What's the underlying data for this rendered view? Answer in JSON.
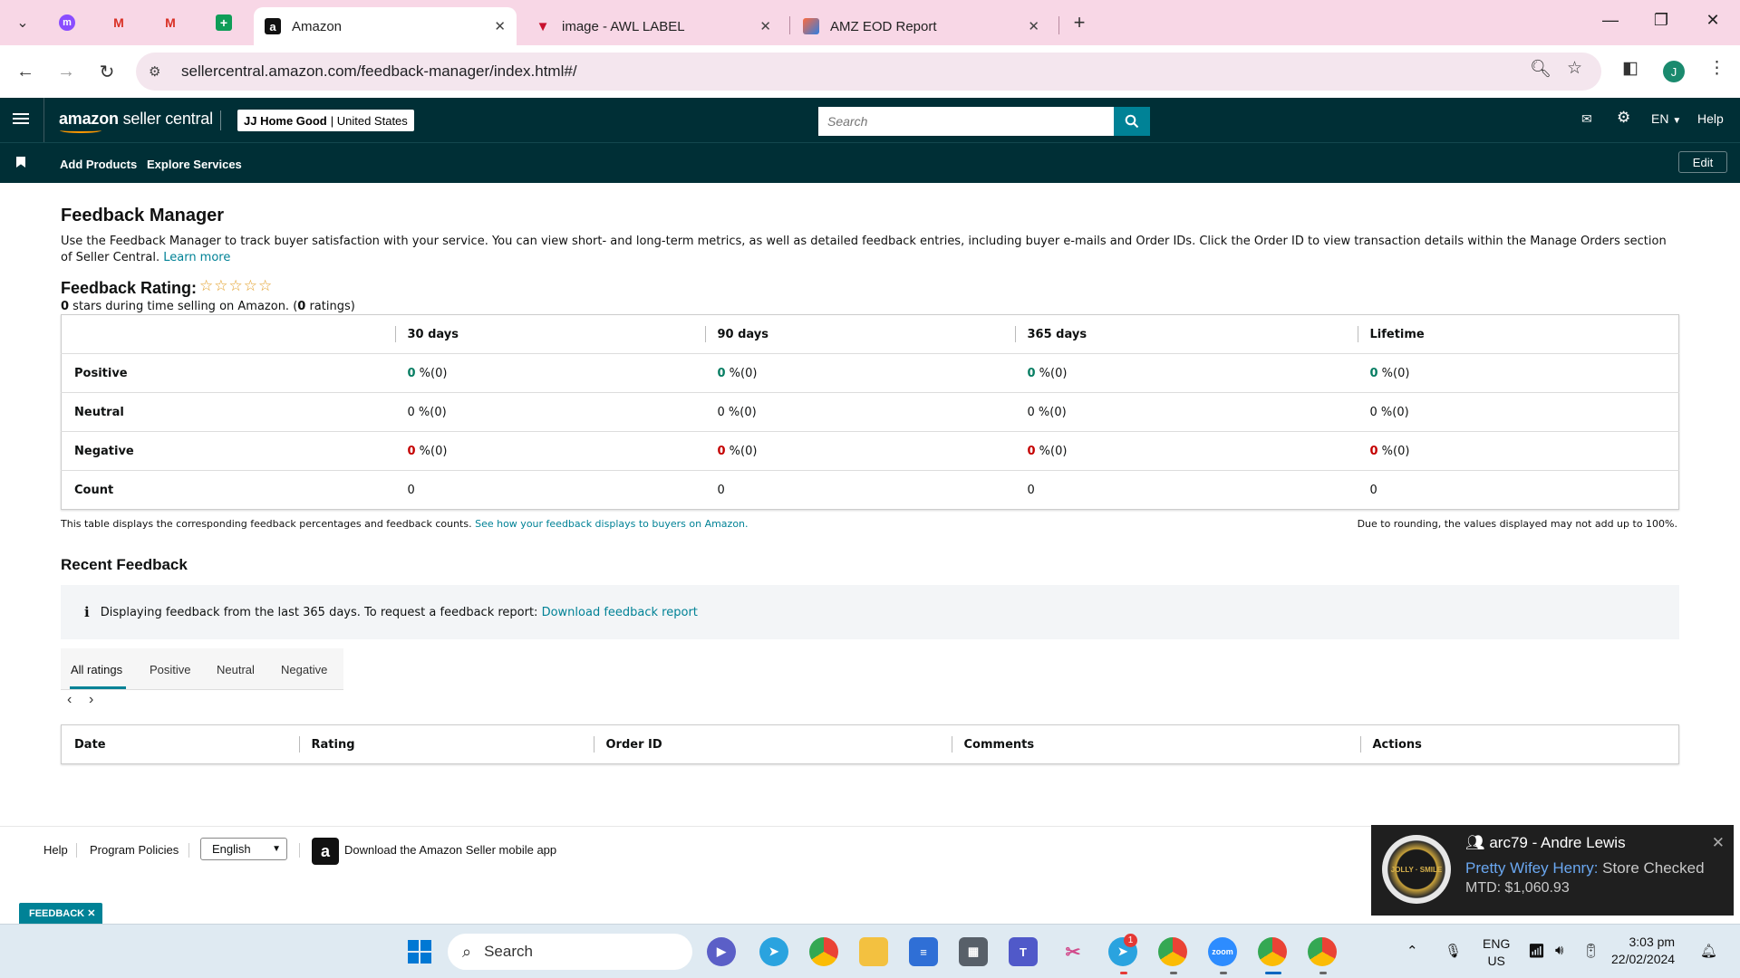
{
  "browser": {
    "tabs": [
      {
        "title": "Amazon"
      },
      {
        "title": "image - AWL LABEL"
      },
      {
        "title": "AMZ EOD Report"
      }
    ],
    "url": "sellercentral.amazon.com/feedback-manager/index.html#/",
    "profile_initial": "J"
  },
  "header": {
    "logo_text_bold": "amazon",
    "logo_text_rest": " seller central",
    "store_name": "JJ Home Good",
    "store_region": "| United States",
    "search_placeholder": "Search",
    "language": "EN",
    "help": "Help"
  },
  "nav": {
    "items": [
      "Add Products",
      "Explore Services"
    ],
    "edit": "Edit"
  },
  "page": {
    "title": "Feedback Manager",
    "description": "Use the Feedback Manager to track buyer satisfaction with your service. You can view short- and long-term metrics, as well as detailed feedback entries, including buyer e-mails and Order IDs. Click the Order ID to view transaction details within the Manage Orders section of Seller Central.",
    "learn_more": "Learn more",
    "rating_title": "Feedback Rating:",
    "stars": "☆☆☆☆☆",
    "rating_stars": "0",
    "rating_sub_mid": " stars during time selling on Amazon. (",
    "rating_count": "0",
    "rating_sub_end": " ratings)"
  },
  "feedback_table": {
    "columns": [
      "30 days",
      "90 days",
      "365 days",
      "Lifetime"
    ],
    "rows": [
      {
        "label": "Positive",
        "values": [
          "0",
          "0",
          "0",
          "0"
        ],
        "suffix": " %(0)"
      },
      {
        "label": "Neutral",
        "values": [
          "0",
          "0",
          "0",
          "0"
        ],
        "suffix": " %(0)"
      },
      {
        "label": "Negative",
        "values": [
          "0",
          "0",
          "0",
          "0"
        ],
        "suffix": " %(0)"
      },
      {
        "label": "Count",
        "values": [
          "0",
          "0",
          "0",
          "0"
        ],
        "suffix": ""
      }
    ],
    "note": "This table displays the corresponding feedback percentages and feedback counts.",
    "note_link": "See how your feedback displays to buyers on Amazon.",
    "rounding_note": "Due to rounding, the values displayed may not add up to 100%."
  },
  "recent": {
    "title": "Recent Feedback",
    "info": "Displaying feedback from the last 365 days. To request a feedback report:",
    "info_link": "Download feedback report",
    "filter_tabs": [
      "All ratings",
      "Positive",
      "Neutral",
      "Negative"
    ],
    "columns": [
      "Date",
      "Rating",
      "Order ID",
      "Comments",
      "Actions"
    ]
  },
  "footer": {
    "help": "Help",
    "policies": "Program Policies",
    "language": "English",
    "app": "Download the Amazon Seller mobile app",
    "feedback_tag": "FEEDBACK"
  },
  "toast": {
    "title": "arc79 - Andre Lewis",
    "sender": "Pretty Wifey Henry:",
    "message": " Store Checked",
    "line2": "MTD: $1,060.93",
    "badge_text": "JOLLY · SMILE"
  },
  "taskbar": {
    "search": "Search",
    "lang_1": "ENG",
    "lang_2": "US",
    "time": "3:03 pm",
    "date": "22/02/2024",
    "telegram_badge": "1"
  },
  "colors": {
    "header_bg": "#002f36",
    "accent": "#008296",
    "positive": "#067d62",
    "negative": "#c40000"
  }
}
